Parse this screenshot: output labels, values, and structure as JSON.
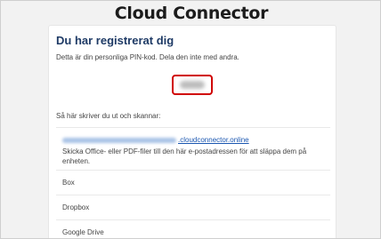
{
  "app": {
    "brand_title": "Cloud Connector"
  },
  "registration": {
    "heading": "Du har registrerat dig",
    "pin_note": "Detta är din personliga PIN-kod. Dela den inte med andra.",
    "pin_value": "",
    "howto_label": "Så här skriver du ut och skannar:"
  },
  "email_option": {
    "address_domain": ".cloudconnector.online",
    "description": "Skicka Office- eller PDF-filer till den här e-postadressen för att släppa dem på enheten."
  },
  "options": [
    {
      "label": "Box"
    },
    {
      "label": "Dropbox"
    },
    {
      "label": "Google Drive"
    }
  ],
  "colors": {
    "heading": "#1f3b66",
    "pin_highlight": "#d00000",
    "link": "#1a56b0"
  }
}
